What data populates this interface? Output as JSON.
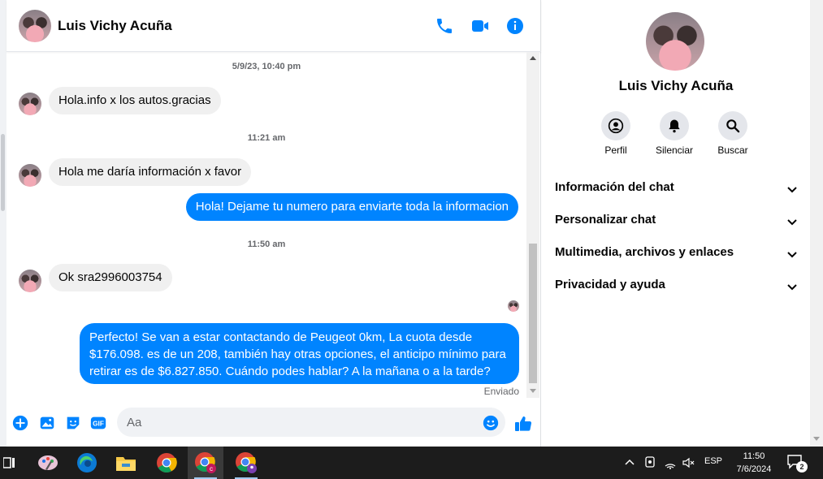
{
  "contact": {
    "name": "Luis Vichy Acuña"
  },
  "header": {
    "icons": [
      "phone-icon",
      "video-icon",
      "info-icon"
    ]
  },
  "messages": [
    {
      "type": "timestamp",
      "text": "5/9/23, 10:40 pm"
    },
    {
      "type": "incoming",
      "text": "Hola.info x los autos.gracias"
    },
    {
      "type": "timestamp",
      "text": "11:21 am"
    },
    {
      "type": "incoming",
      "text": "Hola me daría información x favor"
    },
    {
      "type": "outgoing",
      "text": "Hola! Dejame tu numero para enviarte toda la informacion"
    },
    {
      "type": "timestamp",
      "text": "11:50 am"
    },
    {
      "type": "incoming",
      "text": "Ok sra2996003754"
    },
    {
      "type": "outgoing",
      "lines": [
        "Perfecto!  Se van a estar contactando de Peugeot 0km, La cuota desde",
        "$176.098. es de un 208, también hay otras opciones, el anticipo mínimo para",
        "retirar es de $6.827.850. Cuándo podes hablar? A la mañana o a la tarde?"
      ]
    }
  ],
  "status": {
    "sent": "Enviado"
  },
  "composer": {
    "placeholder": "Aa"
  },
  "info_panel": {
    "actions": [
      {
        "label": "Perfil",
        "icon": "profile-icon"
      },
      {
        "label": "Silenciar",
        "icon": "bell-icon"
      },
      {
        "label": "Buscar",
        "icon": "search-icon"
      }
    ],
    "sections": [
      {
        "label": "Información del chat"
      },
      {
        "label": "Personalizar chat"
      },
      {
        "label": "Multimedia, archivos y enlaces"
      },
      {
        "label": "Privacidad y ayuda"
      }
    ]
  },
  "colors": {
    "accent": "#0084ff",
    "incoming_bubble": "#f0f0f0",
    "taskbar": "#1c1c1c"
  },
  "taskbar": {
    "apps": [
      "task-view-icon",
      "paint-icon",
      "edge-icon",
      "file-explorer-icon",
      "chrome-icon",
      "chrome-profile-icon",
      "chrome-profile-2-icon"
    ],
    "tray": {
      "language": "ESP",
      "time": "11:50",
      "date": "7/6/2024",
      "notifications": "2"
    }
  }
}
